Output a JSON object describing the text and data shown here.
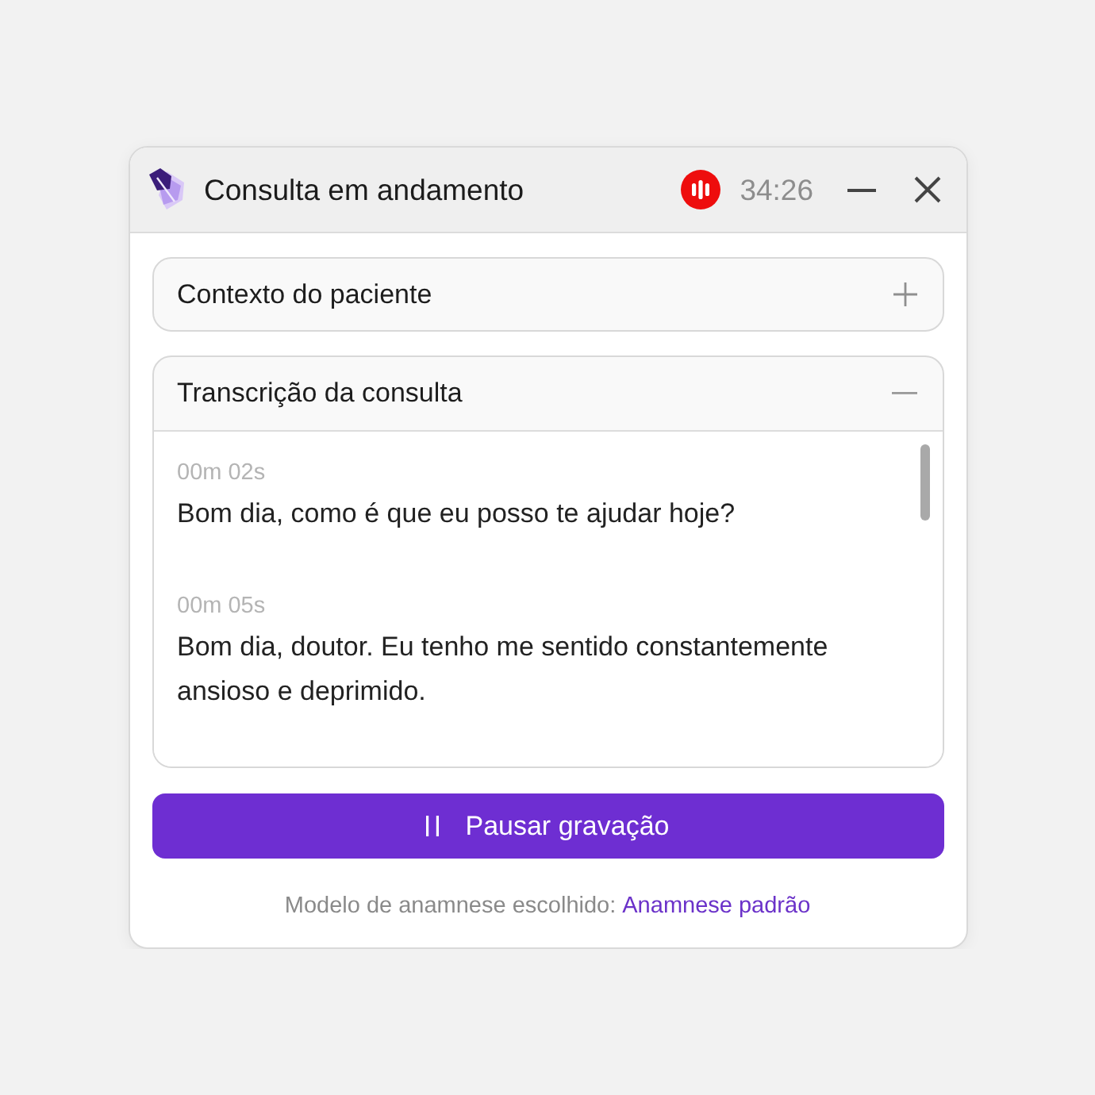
{
  "window": {
    "title": "Consulta em andamento",
    "timer": "34:26"
  },
  "sections": [
    {
      "title": "Contexto do paciente",
      "expanded": false
    },
    {
      "title": "Transcrição da consulta",
      "expanded": true,
      "entries": [
        {
          "time": "00m 02s",
          "text": "Bom dia, como é que eu posso te ajudar hoje?"
        },
        {
          "time": "00m 05s",
          "text": "Bom dia, doutor. Eu tenho me sentido constantemente ansioso e deprimido."
        }
      ]
    }
  ],
  "pause_button": {
    "label": "Pausar gravação"
  },
  "footer": {
    "text": "Modelo de anamnese escolhido:",
    "link": "Anamnese padrão"
  }
}
